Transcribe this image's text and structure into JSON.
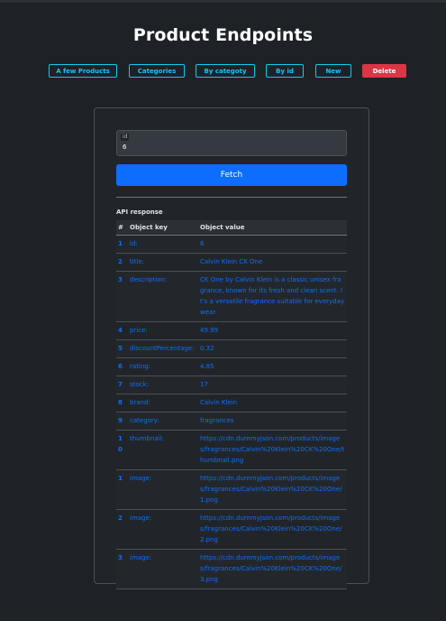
{
  "page": {
    "title": "Product Endpoints"
  },
  "nav": {
    "buttons": [
      {
        "label": "A few Products",
        "style": "outline-info"
      },
      {
        "label": "Categories",
        "style": "outline-info"
      },
      {
        "label": "By categoty",
        "style": "outline-info"
      },
      {
        "label": "By id",
        "style": "outline-info"
      },
      {
        "label": "New",
        "style": "outline-info"
      },
      {
        "label": "Delete",
        "style": "danger"
      }
    ]
  },
  "form": {
    "id_label": "id",
    "id_value": "6",
    "fetch_label": "Fetch"
  },
  "response": {
    "title": "API response",
    "columns": [
      "#",
      "Object key",
      "Object value"
    ],
    "rows": [
      {
        "index": "1",
        "key": "id:",
        "value": "6"
      },
      {
        "index": "2",
        "key": "title:",
        "value": "Calvin Klein CK One"
      },
      {
        "index": "3",
        "key": "description:",
        "value": "CK One by Calvin Klein is a classic unisex fragrance, known for its fresh and clean scent. It's a versatile fragrance suitable for everyday wear."
      },
      {
        "index": "4",
        "key": "price:",
        "value": "49.99"
      },
      {
        "index": "5",
        "key": "discountPercentage:",
        "value": "0.32"
      },
      {
        "index": "6",
        "key": "rating:",
        "value": "4.85"
      },
      {
        "index": "7",
        "key": "stock:",
        "value": "17"
      },
      {
        "index": "8",
        "key": "brand:",
        "value": "Calvin Klein"
      },
      {
        "index": "9",
        "key": "category:",
        "value": "fragrances"
      },
      {
        "index": "10",
        "key": "thumbnail:",
        "value": "https://cdn.dummyjson.com/products/images/fragrances/Calvin%20Klein%20CK%20One/thumbnail.png"
      },
      {
        "index": "1",
        "key": "image:",
        "value": "https://cdn.dummyjson.com/products/images/fragrances/Calvin%20Klein%20CK%20One/1.png"
      },
      {
        "index": "2",
        "key": "image:",
        "value": "https://cdn.dummyjson.com/products/images/fragrances/Calvin%20Klein%20CK%20One/2.png"
      },
      {
        "index": "3",
        "key": "image:",
        "value": "https://cdn.dummyjson.com/products/images/fragrances/Calvin%20Klein%20CK%20One/3.png"
      }
    ]
  },
  "colors": {
    "background": "#1e2227",
    "accent_info": "#0dcaf0",
    "danger": "#dc3545",
    "primary": "#0d6efd"
  }
}
